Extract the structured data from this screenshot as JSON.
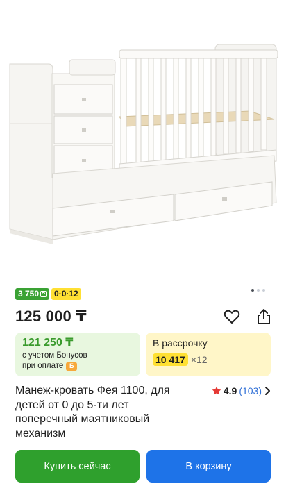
{
  "gallery": {
    "image_alt": "product-photo-crib",
    "current_slide": 1,
    "total_slides": 3
  },
  "badges": {
    "bonus": "3 750",
    "installment": "0·0·12"
  },
  "price": {
    "main": "125 000 ₸"
  },
  "offer_bonus": {
    "price": "121 250 ₸",
    "line1": "с учетом Бонусов",
    "line2": "при оплате"
  },
  "offer_installment": {
    "title": "В рассрочку",
    "amount": "10 417",
    "multiplier": "×12"
  },
  "product": {
    "title": "Манеж-кровать Фея 1100, для детей от 0 до 5-ти лет поперечный маятниковый механизм"
  },
  "rating": {
    "value": "4.9",
    "count": "(103)"
  },
  "actions": {
    "buy_now": "Купить сейчас",
    "add_to_cart": "В корзину"
  },
  "colors": {
    "green": "#2fa02d",
    "blue": "#1e73e8",
    "yellow": "#ffe033",
    "bonus_green": "#3aa234"
  },
  "icons": [
    "heart-icon",
    "share-icon",
    "star-icon",
    "chevron-right-icon",
    "coin-icon"
  ]
}
